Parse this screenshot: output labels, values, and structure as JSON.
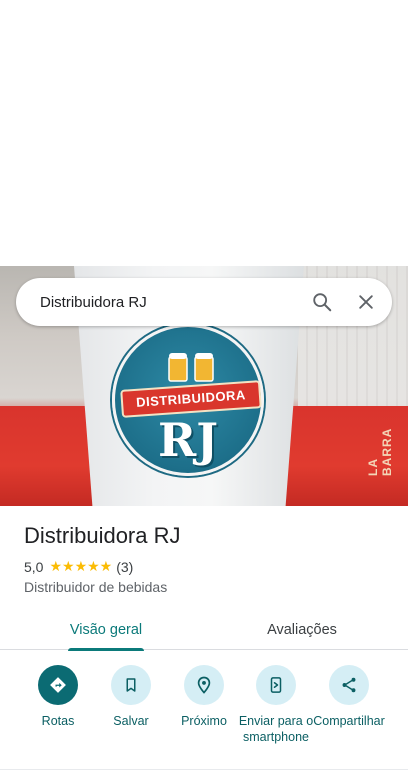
{
  "search": {
    "query": "Distribuidora RJ"
  },
  "hero": {
    "logo_ribbon": "DISTRIBUIDORA",
    "logo_big": "RJ",
    "crate_text": "LA BARRA"
  },
  "place": {
    "title": "Distribuidora RJ",
    "rating": "5,0",
    "stars": "★★★★★",
    "review_count": "(3)",
    "category": "Distribuidor de bebidas"
  },
  "tabs": [
    {
      "label": "Visão geral",
      "selected": true
    },
    {
      "label": "Avaliações",
      "selected": false
    }
  ],
  "actions": [
    {
      "label": "Rotas",
      "icon": "directions-icon"
    },
    {
      "label": "Salvar",
      "icon": "bookmark-icon"
    },
    {
      "label": "Próximo",
      "icon": "nearby-icon"
    },
    {
      "label": "Enviar para o smartphone",
      "icon": "send-to-phone-icon"
    },
    {
      "label": "Compartilhar",
      "icon": "share-icon"
    }
  ],
  "colors": {
    "accent": "#0b7a7a",
    "action_bg": "#d5eef5",
    "primary_action": "#0b6b73",
    "star": "#fbbc04"
  }
}
